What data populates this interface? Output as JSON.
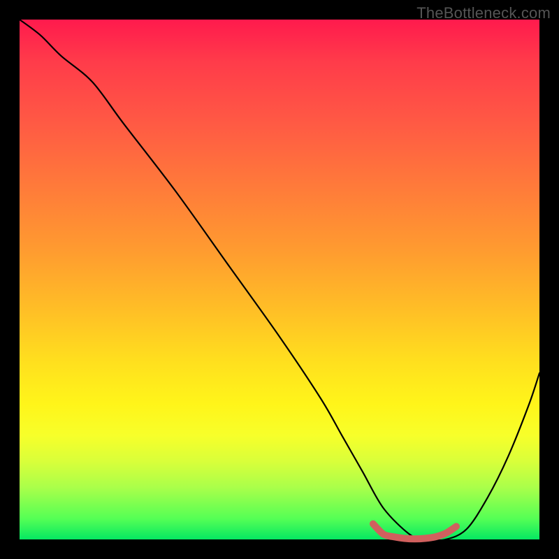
{
  "watermark": "TheBottleneck.com",
  "colors": {
    "frame": "#000000",
    "curve": "#000000",
    "marker": "#d1605e",
    "gradient_top": "#ff1a4d",
    "gradient_bottom": "#05e862"
  },
  "chart_data": {
    "type": "line",
    "title": "",
    "xlabel": "",
    "ylabel": "",
    "xlim": [
      0,
      100
    ],
    "ylim": [
      0,
      100
    ],
    "grid": false,
    "series": [
      {
        "name": "curve",
        "x": [
          0,
          4,
          8,
          14,
          20,
          30,
          40,
          50,
          58,
          62,
          66,
          70,
          75,
          78,
          82,
          86,
          90,
          94,
          98,
          100
        ],
        "values": [
          100,
          97,
          93,
          88,
          80,
          67,
          53,
          39,
          27,
          20,
          13,
          6,
          1,
          0,
          0,
          2,
          8,
          16,
          26,
          32
        ]
      },
      {
        "name": "min-marker",
        "x": [
          68,
          70,
          72,
          74,
          76,
          78,
          80,
          82,
          84
        ],
        "values": [
          3,
          1,
          0.5,
          0.2,
          0.1,
          0.2,
          0.5,
          1.2,
          2.5
        ]
      }
    ],
    "annotations": []
  }
}
